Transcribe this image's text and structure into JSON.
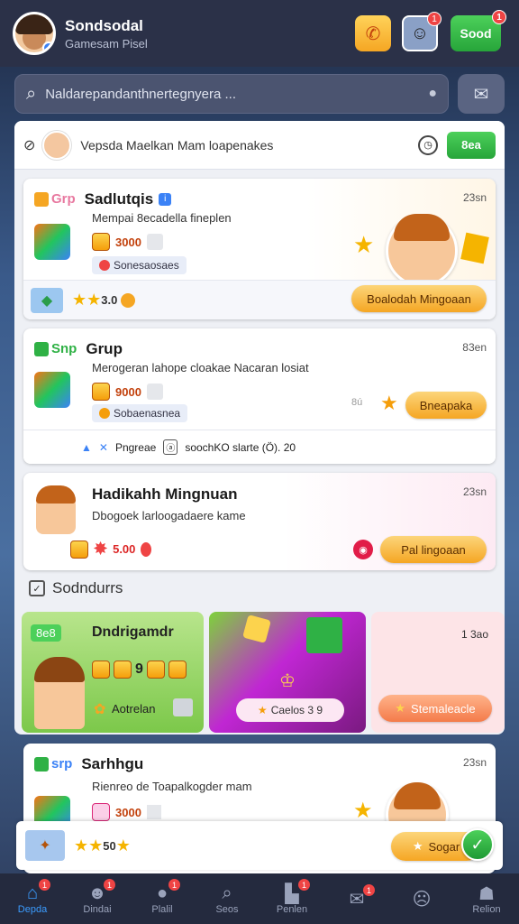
{
  "header": {
    "name": "Sondsodal",
    "subtitle": "Gamesam Pisel",
    "coins_label": "Sood",
    "notif_count_1": "1",
    "notif_count_2": "1"
  },
  "search": {
    "placeholder": "Naldarepandanthnertegnyera ..."
  },
  "filter": {
    "text": "Vepsda Maelkan Mam loapenakes",
    "button": "8ea"
  },
  "cards": [
    {
      "tag": "Grp",
      "title": "Sadlutqis",
      "time": "23sn",
      "desc": "Mempai 8ecadella fineplen",
      "coins": "3000",
      "pill": "Sonesaosaes",
      "rating": "3.0",
      "action": "Boalodah Mingoaan",
      "tag_color": "#f0a020"
    },
    {
      "tag": "Snp",
      "title": "Grup",
      "time": "83en",
      "desc": "Merogeran lahope cloakae Nacaran losiat",
      "coins": "9000",
      "pill": "Sobaenasnea",
      "side_label": "8ú",
      "action": "Bneapaka",
      "footer_a": "Pngreae",
      "footer_b": "soochKO slarte (Ö). 20"
    },
    {
      "title": "Hadikahh Mingnuan",
      "time": "23sn",
      "desc": "Dbogoek larloogadaere kame",
      "coins": "5.00",
      "action": "Pal lingoaan"
    },
    {
      "tag": "srp",
      "title": "Sarhhgu",
      "time": "23sn",
      "desc": "Rienreo de Toapalkogder mam",
      "coins": "3000"
    }
  ],
  "section": {
    "title": "Sodndurrs"
  },
  "tiles": [
    {
      "badge": "8e8",
      "title": "Dndrigamdr",
      "coins": "9",
      "footer": "Aotrelan"
    },
    {
      "label": "Caelos 3 9"
    },
    {
      "top": "1 3ao",
      "button": "Stemaleacle"
    }
  ],
  "bottom_bar": {
    "rating": "50",
    "action": "Sogar"
  },
  "nav": [
    {
      "label": "Depda",
      "badge": "1"
    },
    {
      "label": "Dindai",
      "badge": "1"
    },
    {
      "label": "Plalil",
      "badge": "1"
    },
    {
      "label": "Seos",
      "badge": ""
    },
    {
      "label": "Penlen",
      "badge": "1"
    },
    {
      "label": "",
      "badge": "1"
    },
    {
      "label": "",
      "badge": ""
    },
    {
      "label": "Relion",
      "badge": ""
    }
  ],
  "colors": {
    "accent": "#3b9cff",
    "green": "#2fb145",
    "orange": "#f5a623"
  }
}
